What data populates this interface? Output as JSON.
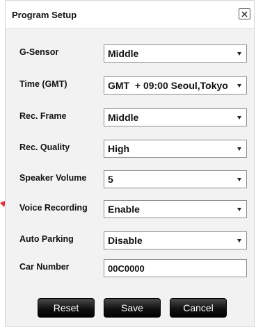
{
  "dialog": {
    "title": "Program Setup",
    "close_icon": "close-x-icon"
  },
  "rows": [
    {
      "label": "G-Sensor",
      "value": "Middle",
      "type": "select"
    },
    {
      "label": "Time (GMT)",
      "value": "GMT  + 09:00 Seoul,Tokyo",
      "type": "select"
    },
    {
      "label": "Rec. Frame",
      "value": "Middle",
      "type": "select"
    },
    {
      "label": "Rec. Quality",
      "value": "High",
      "type": "select"
    },
    {
      "label": "Speaker Volume",
      "value": "5",
      "type": "select"
    },
    {
      "label": "Voice Recording",
      "value": "Enable",
      "type": "select"
    },
    {
      "label": "Auto Parking",
      "value": "Disable",
      "type": "select"
    },
    {
      "label": "Car Number",
      "value": "00C0000",
      "type": "text"
    }
  ],
  "buttons": {
    "reset": "Reset",
    "save": "Save",
    "cancel": "Cancel"
  },
  "colors": {
    "dialog_bg": "#f2f2f2",
    "button_bg": "#111111",
    "annotation_arrow": "#e53030"
  }
}
